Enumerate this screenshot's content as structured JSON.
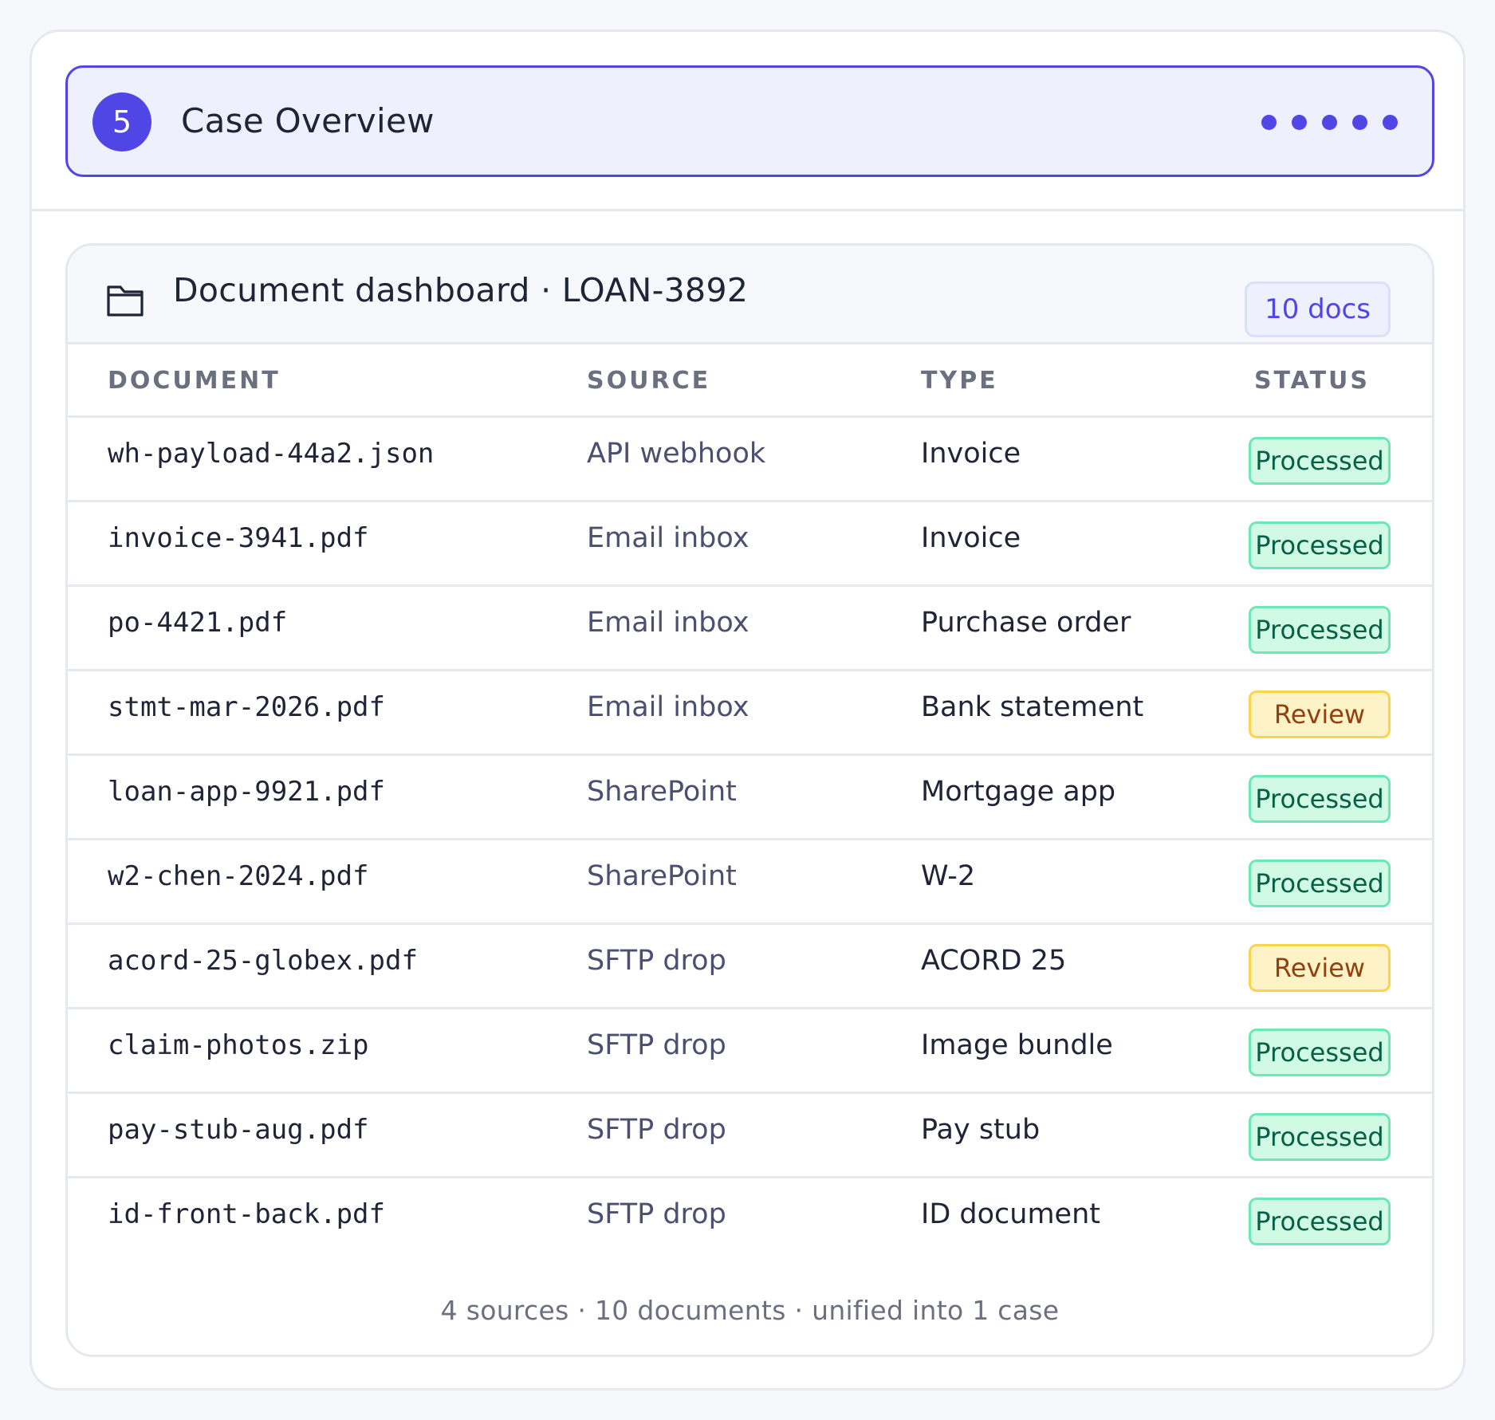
{
  "step": {
    "number": "5",
    "title": "Case Overview",
    "progress_dots": 5
  },
  "dashboard": {
    "title": "Document dashboard · LOAN-3892",
    "doc_count": "10 docs",
    "folder_icon": "folder-icon"
  },
  "table": {
    "headers": {
      "document": "DOCUMENT",
      "source": "SOURCE",
      "type": "TYPE",
      "status": "STATUS"
    },
    "rows": [
      {
        "document": "wh-payload-44a2.json",
        "source": "API webhook",
        "type": "Invoice",
        "status": "Processed",
        "status_kind": "processed"
      },
      {
        "document": "invoice-3941.pdf",
        "source": "Email inbox",
        "type": "Invoice",
        "status": "Processed",
        "status_kind": "processed"
      },
      {
        "document": "po-4421.pdf",
        "source": "Email inbox",
        "type": "Purchase order",
        "status": "Processed",
        "status_kind": "processed"
      },
      {
        "document": "stmt-mar-2026.pdf",
        "source": "Email inbox",
        "type": "Bank statement",
        "status": "Review",
        "status_kind": "review"
      },
      {
        "document": "loan-app-9921.pdf",
        "source": "SharePoint",
        "type": "Mortgage app",
        "status": "Processed",
        "status_kind": "processed"
      },
      {
        "document": "w2-chen-2024.pdf",
        "source": "SharePoint",
        "type": "W-2",
        "status": "Processed",
        "status_kind": "processed"
      },
      {
        "document": "acord-25-globex.pdf",
        "source": "SFTP drop",
        "type": "ACORD 25",
        "status": "Review",
        "status_kind": "review"
      },
      {
        "document": "claim-photos.zip",
        "source": "SFTP drop",
        "type": "Image bundle",
        "status": "Processed",
        "status_kind": "processed"
      },
      {
        "document": "pay-stub-aug.pdf",
        "source": "SFTP drop",
        "type": "Pay stub",
        "status": "Processed",
        "status_kind": "processed"
      },
      {
        "document": "id-front-back.pdf",
        "source": "SFTP drop",
        "type": "ID document",
        "status": "Processed",
        "status_kind": "processed"
      }
    ]
  },
  "footer": "4 sources · 10 documents · unified into 1 case",
  "colors": {
    "accent": "#4f46e5",
    "processed_bg": "#d1fae5",
    "processed_text": "#065f46",
    "review_bg": "#fef3c7",
    "review_text": "#92400e"
  }
}
